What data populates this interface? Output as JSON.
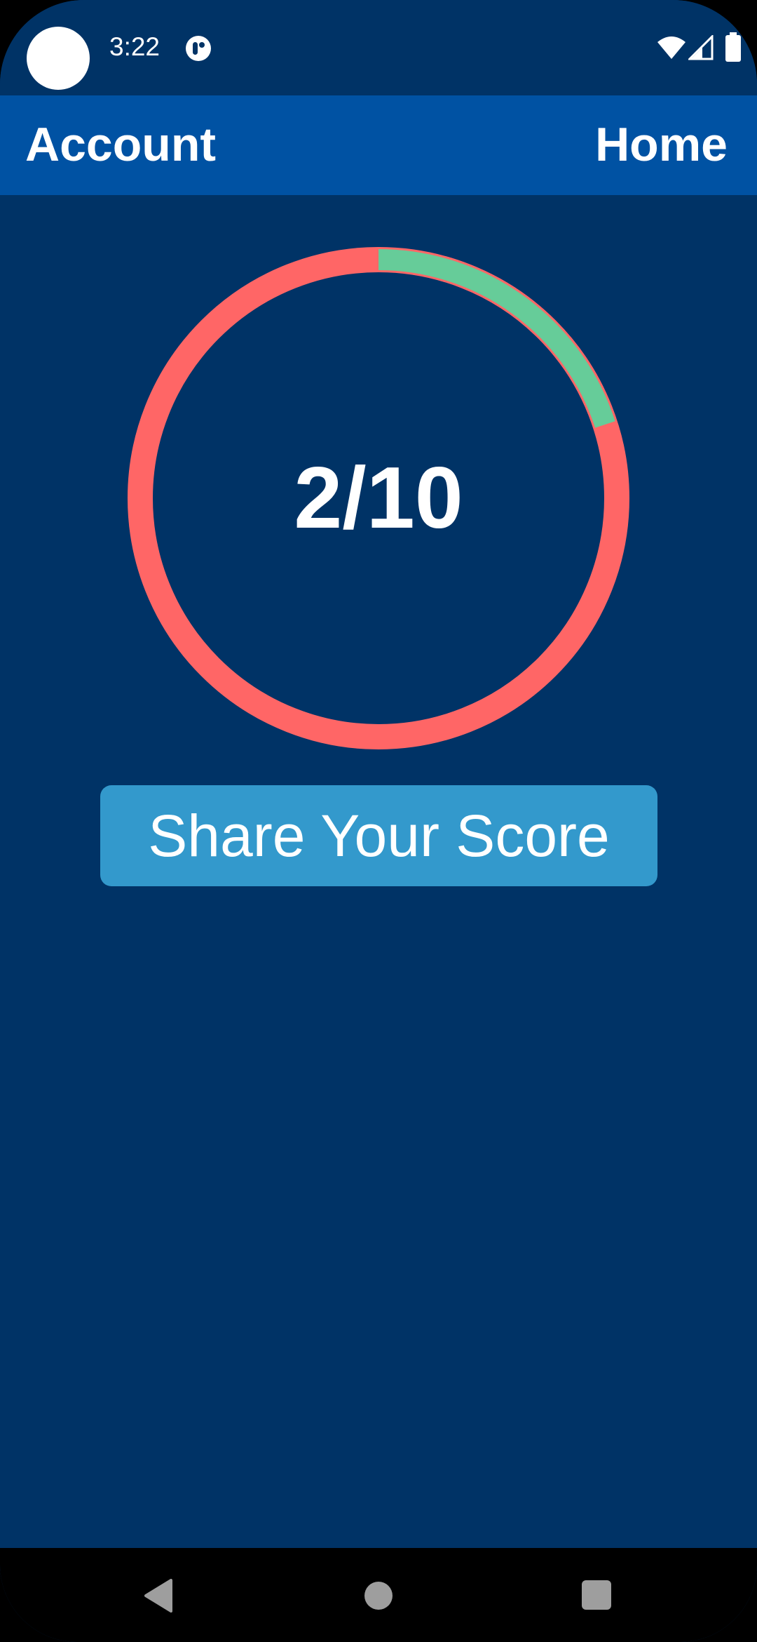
{
  "status_bar": {
    "time": "3:22",
    "icons": [
      "camera-cutout",
      "notification-icon",
      "wifi-icon",
      "cell-signal-icon",
      "battery-icon"
    ]
  },
  "app_bar": {
    "account_label": "Account",
    "home_label": "Home",
    "background_color": "#0052a3"
  },
  "score": {
    "text": "2/10",
    "correct": 2,
    "total": 10,
    "correct_color": "#66cc99",
    "remaining_color": "#ff6666"
  },
  "share_button": {
    "label": "Share Your Score",
    "color": "#3399cc"
  },
  "nav_bar": {
    "icons": [
      "back-icon",
      "home-icon",
      "recents-icon"
    ]
  },
  "colors": {
    "background": "#003366"
  }
}
